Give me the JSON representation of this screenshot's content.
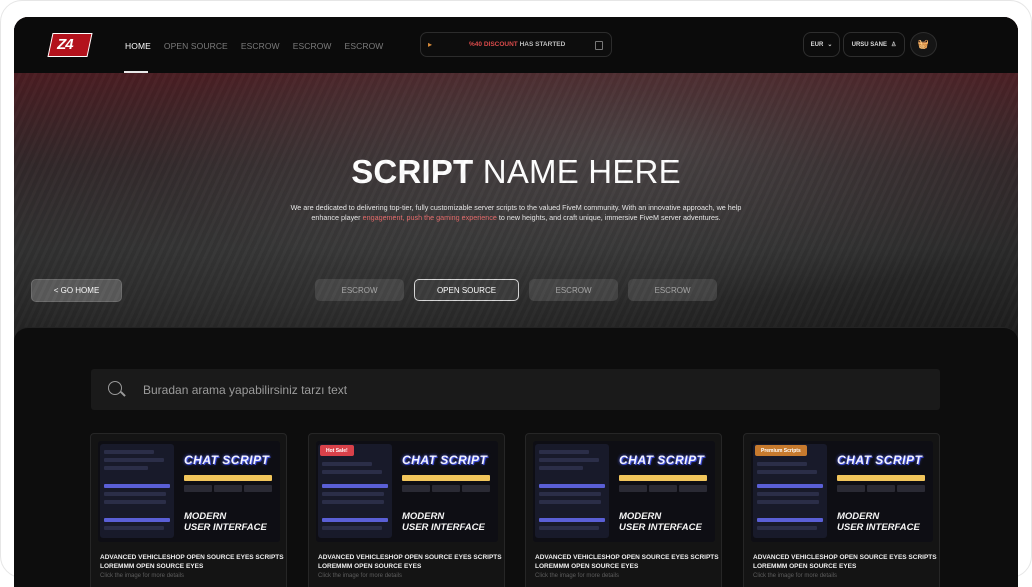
{
  "nav": {
    "items": [
      {
        "label": "HOME",
        "active": true
      },
      {
        "label": "OPEN SOURCE",
        "active": false
      },
      {
        "label": "ESCROW",
        "active": false
      },
      {
        "label": "ESCROW",
        "active": false
      },
      {
        "label": "ESCROW",
        "active": false
      }
    ]
  },
  "promo": {
    "discount": "%40 DISCOUNT",
    "suffix": "HAS STARTED"
  },
  "currency": {
    "label": "EUR"
  },
  "user": {
    "label": "URSU SANE"
  },
  "hero": {
    "title_bold": "SCRIPT",
    "title_rest": "NAME HERE",
    "desc_1": "We are dedicated to delivering top-tier, fully customizable server scripts to the valued FiveM community. With an innovative approach, we help enhance player ",
    "desc_hl": "engagement, push the gaming experience",
    "desc_2": " to new heights, and craft unique, immersive FiveM server adventures.",
    "go_home": "< GO HOME",
    "tabs": [
      {
        "label": "ESCROW",
        "active": false
      },
      {
        "label": "OPEN SOURCE",
        "active": true
      },
      {
        "label": "ESCROW",
        "active": false
      },
      {
        "label": "ESCROW",
        "active": false
      }
    ]
  },
  "search": {
    "placeholder": "Buradan arama yapabilirsiniz tarzı text"
  },
  "products": [
    {
      "badge": "",
      "thumb_title": "CHAT SCRIPT",
      "thumb_sub_1": "MODERN",
      "thumb_sub_2": "USER INTERFACE",
      "name": "ADVANCED VEHICLESHOP OPEN SOURCE EYES  SCRIPTS LOREMMM OPEN SOURCE EYES",
      "hint": "Click the image for more details"
    },
    {
      "badge": "Hot Sale!",
      "badge_color": "#d9414a",
      "thumb_title": "CHAT SCRIPT",
      "thumb_sub_1": "MODERN",
      "thumb_sub_2": "USER INTERFACE",
      "name": "ADVANCED VEHICLESHOP OPEN SOURCE EYES  SCRIPTS LOREMMM OPEN SOURCE EYES",
      "hint": "Click the image for more details"
    },
    {
      "badge": "",
      "thumb_title": "CHAT SCRIPT",
      "thumb_sub_1": "MODERN",
      "thumb_sub_2": "USER INTERFACE",
      "name": "ADVANCED VEHICLESHOP OPEN SOURCE EYES  SCRIPTS LOREMMM OPEN SOURCE EYES",
      "hint": "Click the image for more details"
    },
    {
      "badge": "Premium Scripts",
      "badge_color": "#c77a2e",
      "thumb_title": "CHAT SCRIPT",
      "thumb_sub_1": "MODERN",
      "thumb_sub_2": "USER INTERFACE",
      "name": "ADVANCED VEHICLESHOP OPEN SOURCE EYES  SCRIPTS LOREMMM OPEN SOURCE EYES",
      "hint": "Click the image for more details"
    }
  ],
  "colors": {
    "accent_red": "#d94a4a",
    "page_bg": "#0a0a0a"
  }
}
